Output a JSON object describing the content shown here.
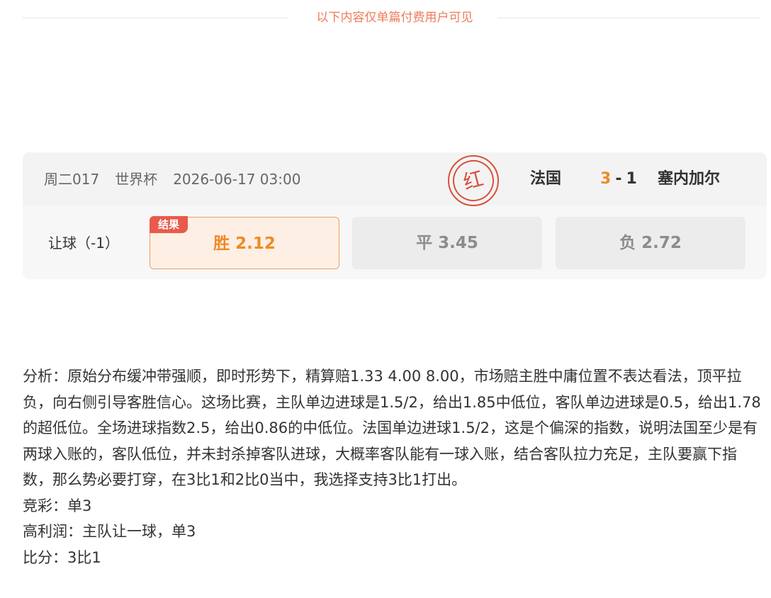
{
  "paywall": {
    "notice": "以下内容仅单篇付费用户可见"
  },
  "match": {
    "code": "周二017",
    "league": "世界杯",
    "datetime": "2026-06-17 03:00",
    "stamp_text": "红",
    "home_team": "法国",
    "home_score": "3",
    "score_separator": "-",
    "away_score": "1",
    "away_team": "塞内加尔",
    "handicap_label": "让球（-1）",
    "result_tag": "结果",
    "odds": {
      "win": "胜 2.12",
      "draw": "平 3.45",
      "lose": "负 2.72"
    }
  },
  "analysis": {
    "body": "分析：原始分布缓冲带强顺，即时形势下，精算赔1.33 4.00 8.00，市场赔主胜中庸位置不表达看法，顶平拉负，向右侧引导客胜信心。这场比赛，主队单边进球是1.5/2，给出1.85中低位，客队单边进球是0.5，给出1.78的超低位。全场进球指数2.5，给出0.86的中低位。法国单边进球1.5/2，这是个偏深的指数，说明法国至少是有两球入账的，客队低位，并未封杀掉客队进球，大概率客队能有一球入账，结合客队拉力充足，主队要赢下指数，那么势必要打穿，在3比1和2比0当中，我选择支持3比1打出。",
    "jingcai": "竞彩：单3",
    "high_profit": "高利润：主队让一球，单3",
    "score_pick": "比分：3比1"
  },
  "colors": {
    "accent_orange": "#f08a24",
    "stamp_red": "#d9503a",
    "notice_text": "#ef7b5a"
  }
}
